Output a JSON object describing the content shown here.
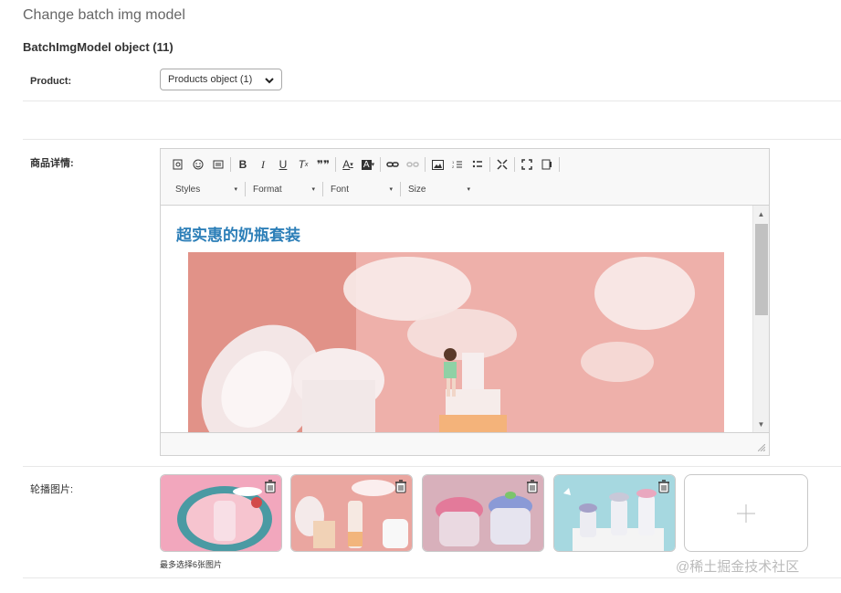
{
  "page": {
    "title": "Change batch img model",
    "object_title": "BatchImgModel object (11)"
  },
  "product": {
    "label": "Product:",
    "selected": "Products object (1)"
  },
  "details": {
    "label": "商品详情:",
    "toolbar_combos": [
      "Styles",
      "Format",
      "Font",
      "Size"
    ],
    "toolbar_icons": [
      "preview-icon",
      "smiley-icon",
      "special-char-icon",
      "bold-icon",
      "italic-icon",
      "underline-icon",
      "remove-format-icon",
      "blockquote-icon",
      "text-color-icon",
      "bg-color-icon",
      "link-icon",
      "unlink-icon",
      "image-icon",
      "numbered-list-icon",
      "bulleted-list-icon",
      "maximize-icon",
      "fullscreen-icon",
      "source-icon"
    ],
    "heading": "超实惠的奶瓶套装"
  },
  "carousel": {
    "label": "轮播图片:",
    "hint": "最多选择6张图片",
    "images": [
      "carousel-image-1",
      "carousel-image-2",
      "carousel-image-3",
      "carousel-image-4"
    ]
  },
  "watermark": "@稀土掘金技术社区",
  "colors": {
    "heading": "#2d7fb8",
    "pink": "#e9a39b"
  }
}
